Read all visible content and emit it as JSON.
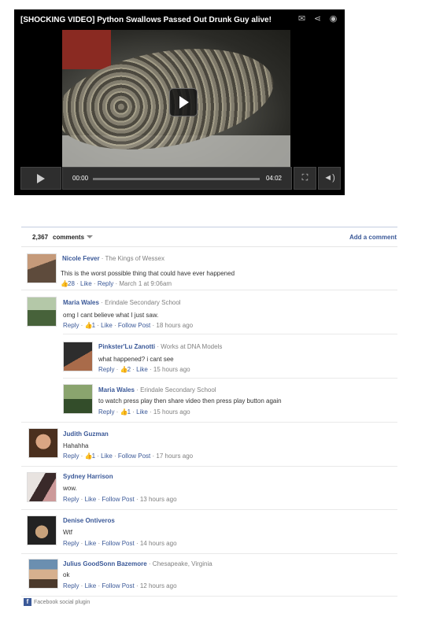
{
  "video": {
    "title": "[SHOCKING VIDEO] Python Swallows Passed Out Drunk Guy alive!",
    "current_time": "00:00",
    "duration": "04:02",
    "progress": 0,
    "icons": [
      "mail-icon",
      "share-icon",
      "watch-later-icon"
    ]
  },
  "comments_header": {
    "count": "2,367",
    "label": "comments",
    "add_label": "Add a comment"
  },
  "comments": [
    {
      "name": "Nicole Fever",
      "meta": "The Kings of Wessex",
      "text": "This is the worst possible thing that could have ever happened",
      "likes": "28",
      "like_label": "Like",
      "reply_label": "Reply",
      "time": "March 1 at 9:06am"
    },
    {
      "name": "Maria Wales",
      "meta": "Erindale Secondary School",
      "text": "omg I cant believe what I just saw.",
      "reply_label": "Reply",
      "likes": "1",
      "like_label": "Like",
      "follow_label": "Follow Post",
      "time": "18 hours ago"
    },
    {
      "name": "Pinkster'Lu Zanotti",
      "meta": "Works at DNA Models",
      "text": "what happened? i cant see",
      "reply_label": "Reply",
      "likes": "2",
      "like_label": "Like",
      "time": "15 hours ago"
    },
    {
      "name": "Maria Wales",
      "meta": "Erindale Secondary School",
      "text": "to watch press play then share video then press play button again",
      "reply_label": "Reply",
      "likes": "1",
      "like_label": "Like",
      "time": "15 hours ago"
    },
    {
      "name": "Judith Guzman",
      "text": "Hahahha",
      "reply_label": "Reply",
      "likes": "1",
      "like_label": "Like",
      "follow_label": "Follow Post",
      "time": "17 hours ago"
    },
    {
      "name": "Sydney Harrison",
      "text": "wow.",
      "reply_label": "Reply",
      "like_label": "Like",
      "follow_label": "Follow Post",
      "time": "13 hours ago"
    },
    {
      "name": "Denise Ontiveros",
      "text": "Wtf",
      "reply_label": "Reply",
      "like_label": "Like",
      "follow_label": "Follow Post",
      "time": "14 hours ago"
    },
    {
      "name": "Julius GoodSonn Bazemore",
      "meta": "Chesapeake, Virginia",
      "text": "ok",
      "reply_label": "Reply",
      "like_label": "Like",
      "follow_label": "Follow Post",
      "time": "12 hours ago"
    }
  ],
  "footer": {
    "label": "Facebook social plugin"
  }
}
